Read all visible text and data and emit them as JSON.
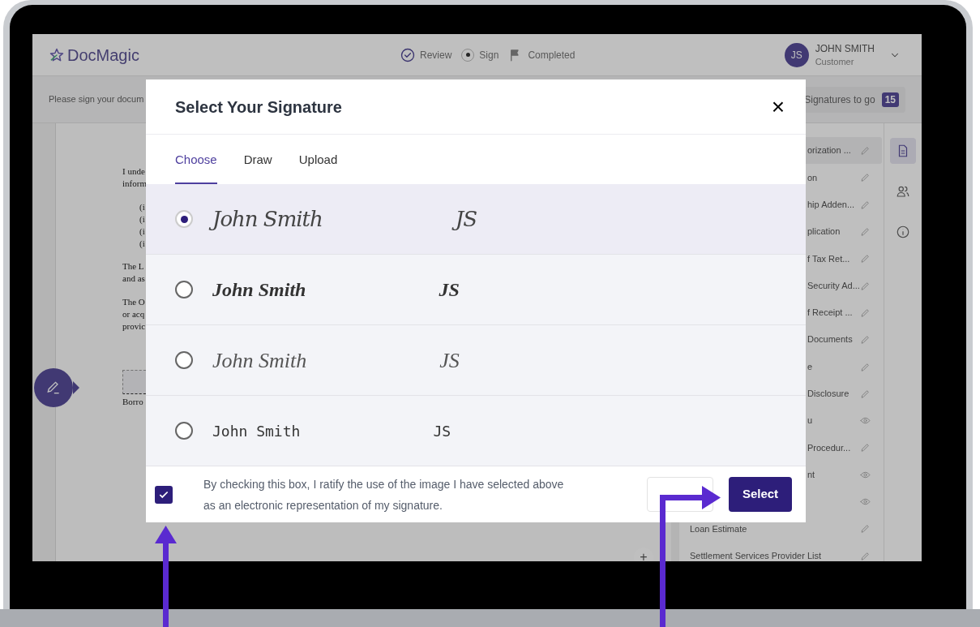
{
  "header": {
    "logo": "DocMagic",
    "steps": [
      {
        "label": "Review",
        "kind": "done"
      },
      {
        "label": "Sign",
        "kind": "current"
      },
      {
        "label": "Completed",
        "kind": "pending"
      }
    ],
    "user": {
      "initials": "JS",
      "name": "JOHN SMITH",
      "role": "Customer"
    }
  },
  "subbar": {
    "message": "Please sign your docum",
    "counter_label": "Signatures to go",
    "counter": "15"
  },
  "document": {
    "blocks": [
      {
        "kind": "text",
        "lines": [
          "I unde",
          "inform"
        ]
      },
      {
        "kind": "list",
        "lines": [
          "(i",
          "(i",
          "(i",
          "(i"
        ]
      },
      {
        "kind": "text",
        "lines": [
          "The L",
          "and as"
        ]
      },
      {
        "kind": "text",
        "lines": [
          "The O",
          "or acq",
          "provic"
        ]
      },
      {
        "kind": "sign",
        "lines": [
          "Borro"
        ]
      }
    ]
  },
  "documents": [
    {
      "label": "orization ...",
      "kind": "edit",
      "selected": true
    },
    {
      "label": "on",
      "kind": "edit",
      "selected": false
    },
    {
      "label": "hip Adden...",
      "kind": "edit",
      "selected": false
    },
    {
      "label": "plication",
      "kind": "edit",
      "selected": false
    },
    {
      "label": "f Tax Ret...",
      "kind": "edit",
      "selected": false
    },
    {
      "label": "Security Ad...",
      "kind": "edit",
      "selected": false
    },
    {
      "label": "f Receipt ...",
      "kind": "edit",
      "selected": false
    },
    {
      "label": "Documents",
      "kind": "edit",
      "selected": false
    },
    {
      "label": "e",
      "kind": "edit",
      "selected": false
    },
    {
      "label": "Disclosure",
      "kind": "edit",
      "selected": false
    },
    {
      "label": "u",
      "kind": "view",
      "selected": false
    },
    {
      "label": "Procedur...",
      "kind": "edit",
      "selected": false
    },
    {
      "label": "nt",
      "kind": "view",
      "selected": false
    },
    {
      "kind": "view",
      "selected": false
    },
    {
      "label": "Loan Estimate",
      "kind": "edit",
      "selected": false
    },
    {
      "label": "Settlement Services Provider List",
      "kind": "edit",
      "selected": false
    }
  ],
  "rail": [
    {
      "kind": "document",
      "selected": true
    },
    {
      "kind": "people",
      "selected": false
    },
    {
      "kind": "info",
      "selected": false
    }
  ],
  "zoom_button": "+",
  "modal": {
    "title": "Select Your Signature",
    "close": "×",
    "tabs": [
      {
        "label": "Choose",
        "selected": true
      },
      {
        "label": "Draw",
        "selected": false
      },
      {
        "label": "Upload",
        "selected": false
      }
    ],
    "options": [
      {
        "name": "John Smith",
        "initials": "JS",
        "kind": "script",
        "selected": true
      },
      {
        "name": "John Smith",
        "initials": "JS",
        "kind": "brush",
        "selected": false
      },
      {
        "name": "John Smith",
        "initials": "JS",
        "kind": "thin",
        "selected": false
      },
      {
        "name": "John Smith",
        "initials": "JS",
        "kind": "hand",
        "selected": false
      }
    ],
    "consent": {
      "checked": true,
      "text": "By checking this box, I ratify the use of the image I have selected above as an electronic representation of my signature."
    },
    "buttons": [
      {
        "kind": "secondary"
      },
      {
        "kind": "primary",
        "label": "Select"
      }
    ]
  }
}
